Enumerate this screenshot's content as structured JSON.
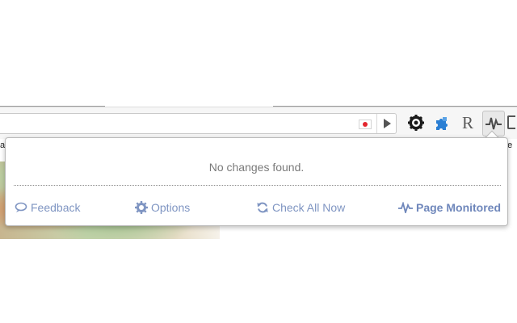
{
  "page": {
    "left_fragment": "a",
    "right_fragment": "he"
  },
  "toolbar": {
    "extensions": [
      {
        "name": "gear-icon"
      },
      {
        "name": "puzzle-icon"
      },
      {
        "name": "r-icon",
        "glyph": "R"
      },
      {
        "name": "pulse-icon",
        "active": true
      }
    ]
  },
  "popup": {
    "message": "No changes found.",
    "links": {
      "feedback": "Feedback",
      "options": "Options",
      "check_all": "Check All Now",
      "page_monitored": "Page Monitored"
    }
  },
  "colors": {
    "link": "#7f95c2",
    "flag_red": "#e3262e",
    "puzzle_blue": "#2a7fd4"
  }
}
